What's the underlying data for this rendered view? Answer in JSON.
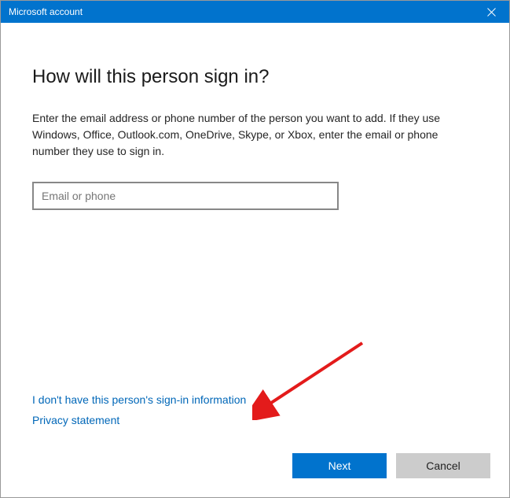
{
  "window": {
    "title": "Microsoft account"
  },
  "main": {
    "heading": "How will this person sign in?",
    "description": "Enter the email address or phone number of the person you want to add. If they use Windows, Office, Outlook.com, OneDrive, Skype, or Xbox, enter the email or phone number they use to sign in.",
    "input_placeholder": "Email or phone",
    "input_value": ""
  },
  "links": {
    "no_info": "I don't have this person's sign-in information",
    "privacy": "Privacy statement"
  },
  "buttons": {
    "next": "Next",
    "cancel": "Cancel"
  }
}
